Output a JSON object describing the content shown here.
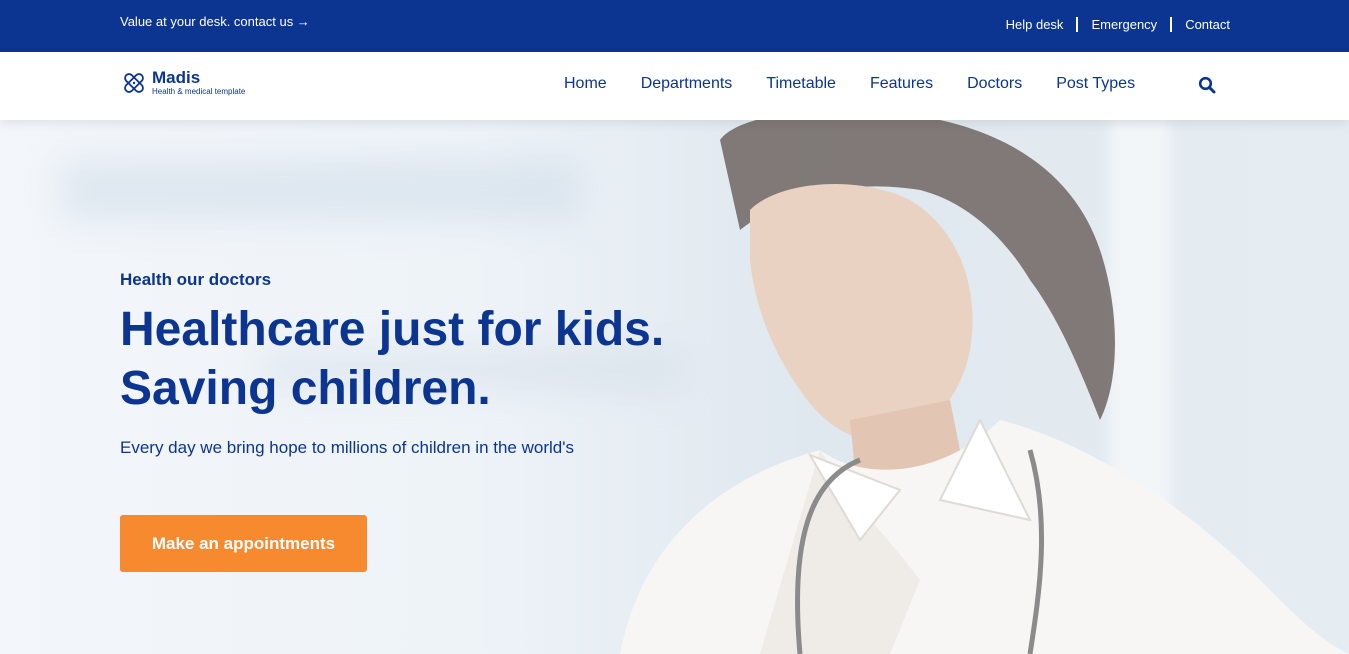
{
  "topbar": {
    "promo": "Value at your desk. contact us →",
    "links": [
      "Help desk",
      "Emergency",
      "Contact"
    ]
  },
  "brand": {
    "name": "Madis",
    "tagline": "Health & medical template",
    "icon": "bandage-logo-icon"
  },
  "nav": {
    "items": [
      "Home",
      "Departments",
      "Timetable",
      "Features",
      "Doctors",
      "Post Types"
    ],
    "search_icon": "search-icon"
  },
  "hero": {
    "eyebrow": "Health our doctors",
    "headline_line1": "Healthcare just for kids.",
    "headline_line2": "Saving children.",
    "subtext": "Every day we bring hope to millions of children in the world's",
    "cta_label": "Make an appointments"
  },
  "colors": {
    "primary": "#0b3590",
    "accent": "#f7892f",
    "white": "#ffffff"
  }
}
